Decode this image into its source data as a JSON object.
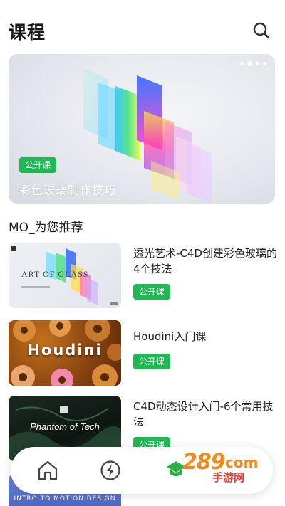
{
  "header": {
    "title": "课程"
  },
  "banner": {
    "badge": "公开课",
    "caption": "彩色玻璃制作技巧",
    "slide_count": 4,
    "active_slide": 2
  },
  "recommend": {
    "title": "MO_为您推荐",
    "courses": [
      {
        "title": "透光艺术-C4D创建彩色玻璃的4个技法",
        "badge": "公开课",
        "thumb_text": "ART OF GLASS"
      },
      {
        "title": "Houdini入门课",
        "badge": "公开课",
        "thumb_text": "Houdini"
      },
      {
        "title": "C4D动态设计入门-6个常用技法",
        "badge": "公开课",
        "thumb_text": "Phantom of Tech"
      }
    ],
    "partial_thumb_text": "INTRO TO MOTION DESIGN"
  },
  "nav": {
    "items": [
      "home-icon",
      "lightning-icon"
    ]
  },
  "watermark": {
    "number": "289",
    "suffix": "com",
    "text": "手游网"
  },
  "colors": {
    "accent": "#1fb954",
    "watermark_orange": "#f08a1c",
    "watermark_red": "#e3403a"
  }
}
